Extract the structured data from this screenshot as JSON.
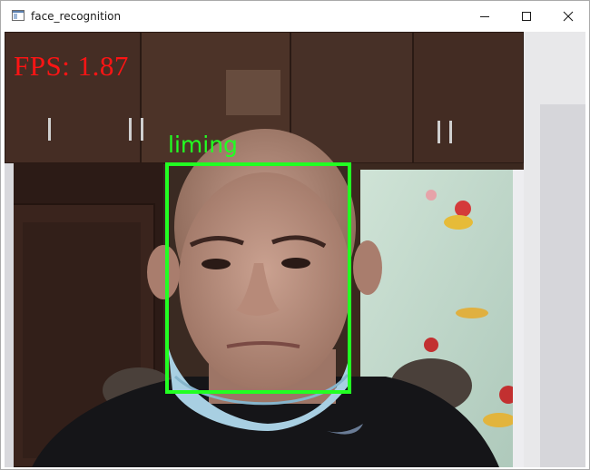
{
  "window": {
    "title": "face_recognition",
    "icons": {
      "app": "app-window-icon",
      "minimize": "minimize-icon",
      "maximize": "maximize-icon",
      "close": "close-icon"
    }
  },
  "overlay": {
    "fps_text": "FPS: 1.87",
    "fps_color": "#ff1414",
    "face_name": "liming",
    "box_color": "#22ff22"
  }
}
